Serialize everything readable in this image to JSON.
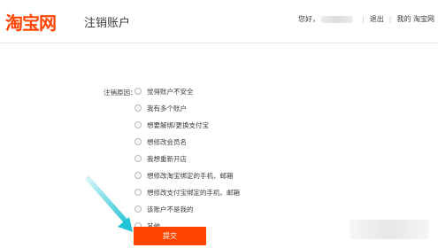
{
  "header": {
    "logo_text": "淘宝网",
    "page_title": "注销账户",
    "greeting": "您好，",
    "logout_label": "退出",
    "my_taobao_label": "我的 淘宝网"
  },
  "form": {
    "reason_label": "注销原因：",
    "reasons": [
      "觉得账户不安全",
      "我有多个账户",
      "想要解绑/更换支付宝",
      "想修改会员名",
      "我想重新开店",
      "想修改淘宝绑定的手机、邮箱",
      "想修改支付宝绑定的手机、邮箱",
      "该账户不是我的",
      "其他"
    ],
    "submit_label": "提交"
  },
  "colors": {
    "brand_orange": "#ff4400",
    "annotation_arrow": "#22c3d6"
  }
}
